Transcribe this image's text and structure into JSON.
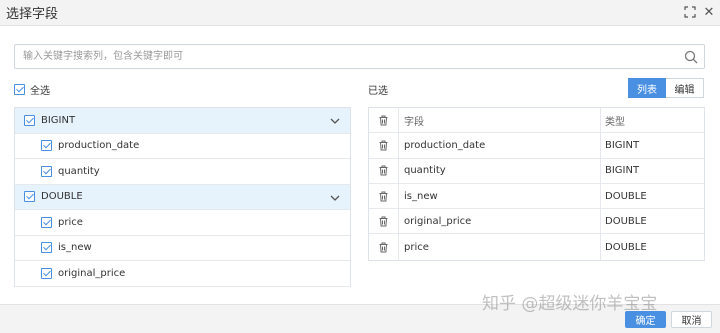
{
  "dialog": {
    "title": "选择字段",
    "expand_icon": "expand-icon",
    "close_icon": "close-icon",
    "close_glyph": "✕"
  },
  "search": {
    "placeholder": "输入关键字搜索列，包含关键字即可",
    "value": "",
    "icon": "search-icon"
  },
  "left": {
    "select_all_label": "全选",
    "groups": [
      {
        "label": "BIGINT",
        "items": [
          "production_date",
          "quantity"
        ]
      },
      {
        "label": "DOUBLE",
        "items": [
          "price",
          "is_new",
          "original_price"
        ]
      }
    ]
  },
  "right": {
    "title": "已选",
    "tabs": [
      {
        "label": "列表",
        "active": true
      },
      {
        "label": "编辑",
        "active": false
      }
    ],
    "columns": {
      "name": "字段",
      "type": "类型"
    },
    "rows": [
      {
        "name": "production_date",
        "type": "BIGINT"
      },
      {
        "name": "quantity",
        "type": "BIGINT"
      },
      {
        "name": "is_new",
        "type": "DOUBLE"
      },
      {
        "name": "original_price",
        "type": "DOUBLE"
      },
      {
        "name": "price",
        "type": "DOUBLE"
      }
    ]
  },
  "footer": {
    "watermark": "知乎 @超级迷你羊宝宝",
    "ok_label": "确定",
    "cancel_label": "取消"
  },
  "colors": {
    "accent": "#4a90e2",
    "group_bg": "#e6f2fc"
  }
}
